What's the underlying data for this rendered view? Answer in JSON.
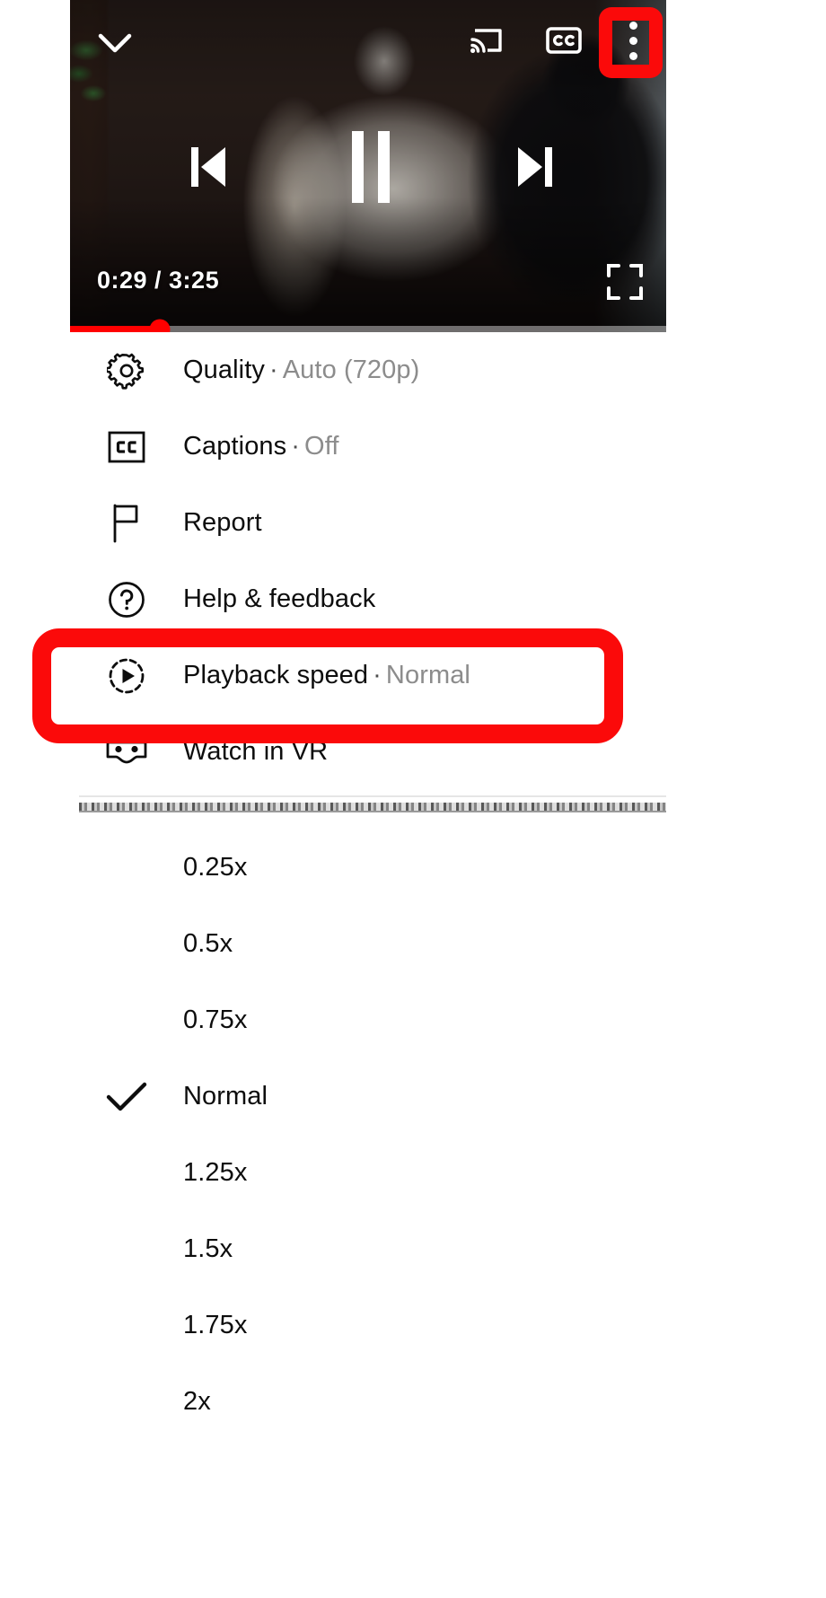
{
  "player": {
    "collapse_icon": "chevron-down-icon",
    "cast_icon": "cast-icon",
    "captions_icon": "cc-icon",
    "more_options_icon": "more-vertical-icon",
    "previous_icon": "skip-previous-icon",
    "pause_icon": "pause-icon",
    "next_icon": "skip-next-icon",
    "fullscreen_icon": "fullscreen-icon",
    "current_time": "0:29",
    "time_separator": "/",
    "duration": "3:25",
    "time_display": "0:29 / 3:25",
    "progress_percent": 15,
    "progress_color": "#ff0000"
  },
  "menu": {
    "items": [
      {
        "icon": "gear-icon",
        "label": "Quality",
        "separator": "·",
        "value": "Auto (720p)"
      },
      {
        "icon": "cc-icon",
        "label": "Captions",
        "separator": "·",
        "value": "Off"
      },
      {
        "icon": "flag-icon",
        "label": "Report",
        "separator": "",
        "value": ""
      },
      {
        "icon": "help-icon",
        "label": "Help & feedback",
        "separator": "",
        "value": ""
      },
      {
        "icon": "play-speed-icon",
        "label": "Playback speed",
        "separator": "·",
        "value": "Normal"
      },
      {
        "icon": "vr-goggles-icon",
        "label": "Watch in VR",
        "separator": "",
        "value": ""
      }
    ]
  },
  "speed_menu": {
    "selected": "Normal",
    "check_icon": "check-icon",
    "options": [
      {
        "label": "0.25x",
        "selected": false
      },
      {
        "label": "0.5x",
        "selected": false
      },
      {
        "label": "0.75x",
        "selected": false
      },
      {
        "label": "Normal",
        "selected": true
      },
      {
        "label": "1.25x",
        "selected": false
      },
      {
        "label": "1.5x",
        "selected": false
      },
      {
        "label": "1.75x",
        "selected": false
      },
      {
        "label": "2x",
        "selected": false
      }
    ]
  },
  "annotations": {
    "color": "#fb0a0a",
    "highlight_more_button": "more-vertical-icon",
    "highlight_playback_speed_row": "Playback speed"
  }
}
